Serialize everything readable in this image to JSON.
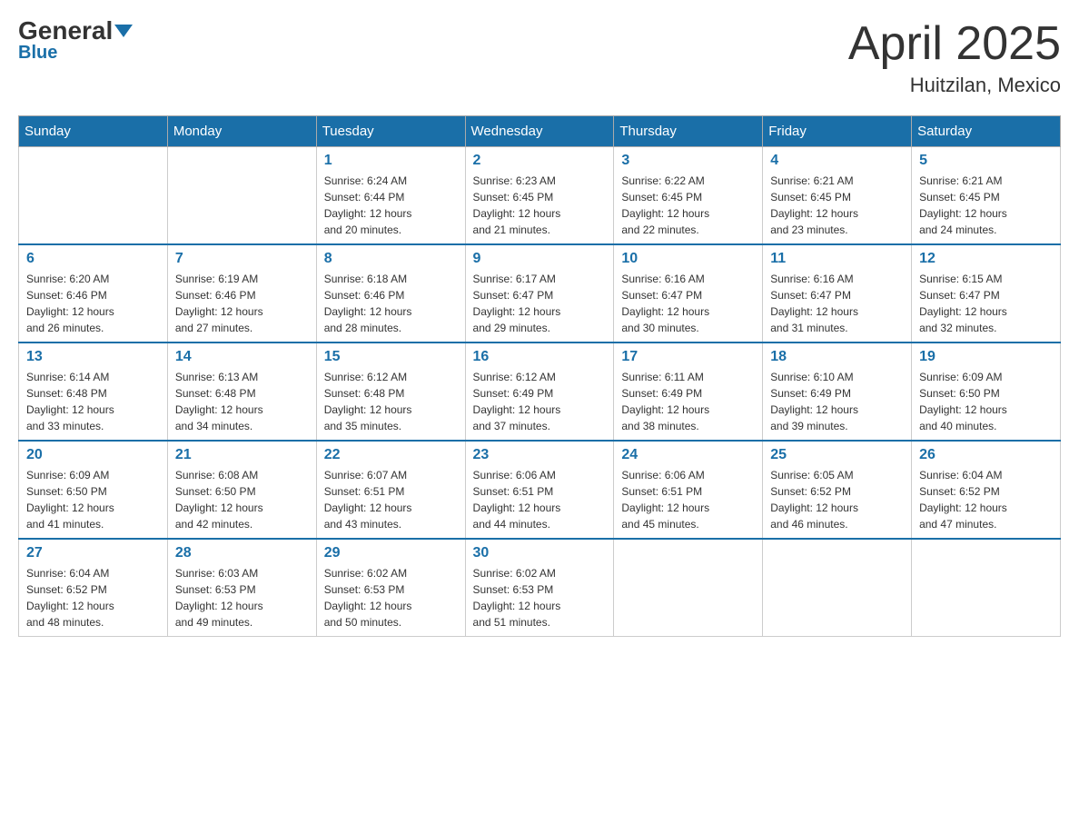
{
  "header": {
    "logo_general": "General",
    "logo_blue": "Blue",
    "month_title": "April 2025",
    "location": "Huitzilan, Mexico"
  },
  "weekdays": [
    "Sunday",
    "Monday",
    "Tuesday",
    "Wednesday",
    "Thursday",
    "Friday",
    "Saturday"
  ],
  "weeks": [
    [
      {
        "day": "",
        "info": ""
      },
      {
        "day": "",
        "info": ""
      },
      {
        "day": "1",
        "info": "Sunrise: 6:24 AM\nSunset: 6:44 PM\nDaylight: 12 hours\nand 20 minutes."
      },
      {
        "day": "2",
        "info": "Sunrise: 6:23 AM\nSunset: 6:45 PM\nDaylight: 12 hours\nand 21 minutes."
      },
      {
        "day": "3",
        "info": "Sunrise: 6:22 AM\nSunset: 6:45 PM\nDaylight: 12 hours\nand 22 minutes."
      },
      {
        "day": "4",
        "info": "Sunrise: 6:21 AM\nSunset: 6:45 PM\nDaylight: 12 hours\nand 23 minutes."
      },
      {
        "day": "5",
        "info": "Sunrise: 6:21 AM\nSunset: 6:45 PM\nDaylight: 12 hours\nand 24 minutes."
      }
    ],
    [
      {
        "day": "6",
        "info": "Sunrise: 6:20 AM\nSunset: 6:46 PM\nDaylight: 12 hours\nand 26 minutes."
      },
      {
        "day": "7",
        "info": "Sunrise: 6:19 AM\nSunset: 6:46 PM\nDaylight: 12 hours\nand 27 minutes."
      },
      {
        "day": "8",
        "info": "Sunrise: 6:18 AM\nSunset: 6:46 PM\nDaylight: 12 hours\nand 28 minutes."
      },
      {
        "day": "9",
        "info": "Sunrise: 6:17 AM\nSunset: 6:47 PM\nDaylight: 12 hours\nand 29 minutes."
      },
      {
        "day": "10",
        "info": "Sunrise: 6:16 AM\nSunset: 6:47 PM\nDaylight: 12 hours\nand 30 minutes."
      },
      {
        "day": "11",
        "info": "Sunrise: 6:16 AM\nSunset: 6:47 PM\nDaylight: 12 hours\nand 31 minutes."
      },
      {
        "day": "12",
        "info": "Sunrise: 6:15 AM\nSunset: 6:47 PM\nDaylight: 12 hours\nand 32 minutes."
      }
    ],
    [
      {
        "day": "13",
        "info": "Sunrise: 6:14 AM\nSunset: 6:48 PM\nDaylight: 12 hours\nand 33 minutes."
      },
      {
        "day": "14",
        "info": "Sunrise: 6:13 AM\nSunset: 6:48 PM\nDaylight: 12 hours\nand 34 minutes."
      },
      {
        "day": "15",
        "info": "Sunrise: 6:12 AM\nSunset: 6:48 PM\nDaylight: 12 hours\nand 35 minutes."
      },
      {
        "day": "16",
        "info": "Sunrise: 6:12 AM\nSunset: 6:49 PM\nDaylight: 12 hours\nand 37 minutes."
      },
      {
        "day": "17",
        "info": "Sunrise: 6:11 AM\nSunset: 6:49 PM\nDaylight: 12 hours\nand 38 minutes."
      },
      {
        "day": "18",
        "info": "Sunrise: 6:10 AM\nSunset: 6:49 PM\nDaylight: 12 hours\nand 39 minutes."
      },
      {
        "day": "19",
        "info": "Sunrise: 6:09 AM\nSunset: 6:50 PM\nDaylight: 12 hours\nand 40 minutes."
      }
    ],
    [
      {
        "day": "20",
        "info": "Sunrise: 6:09 AM\nSunset: 6:50 PM\nDaylight: 12 hours\nand 41 minutes."
      },
      {
        "day": "21",
        "info": "Sunrise: 6:08 AM\nSunset: 6:50 PM\nDaylight: 12 hours\nand 42 minutes."
      },
      {
        "day": "22",
        "info": "Sunrise: 6:07 AM\nSunset: 6:51 PM\nDaylight: 12 hours\nand 43 minutes."
      },
      {
        "day": "23",
        "info": "Sunrise: 6:06 AM\nSunset: 6:51 PM\nDaylight: 12 hours\nand 44 minutes."
      },
      {
        "day": "24",
        "info": "Sunrise: 6:06 AM\nSunset: 6:51 PM\nDaylight: 12 hours\nand 45 minutes."
      },
      {
        "day": "25",
        "info": "Sunrise: 6:05 AM\nSunset: 6:52 PM\nDaylight: 12 hours\nand 46 minutes."
      },
      {
        "day": "26",
        "info": "Sunrise: 6:04 AM\nSunset: 6:52 PM\nDaylight: 12 hours\nand 47 minutes."
      }
    ],
    [
      {
        "day": "27",
        "info": "Sunrise: 6:04 AM\nSunset: 6:52 PM\nDaylight: 12 hours\nand 48 minutes."
      },
      {
        "day": "28",
        "info": "Sunrise: 6:03 AM\nSunset: 6:53 PM\nDaylight: 12 hours\nand 49 minutes."
      },
      {
        "day": "29",
        "info": "Sunrise: 6:02 AM\nSunset: 6:53 PM\nDaylight: 12 hours\nand 50 minutes."
      },
      {
        "day": "30",
        "info": "Sunrise: 6:02 AM\nSunset: 6:53 PM\nDaylight: 12 hours\nand 51 minutes."
      },
      {
        "day": "",
        "info": ""
      },
      {
        "day": "",
        "info": ""
      },
      {
        "day": "",
        "info": ""
      }
    ]
  ]
}
